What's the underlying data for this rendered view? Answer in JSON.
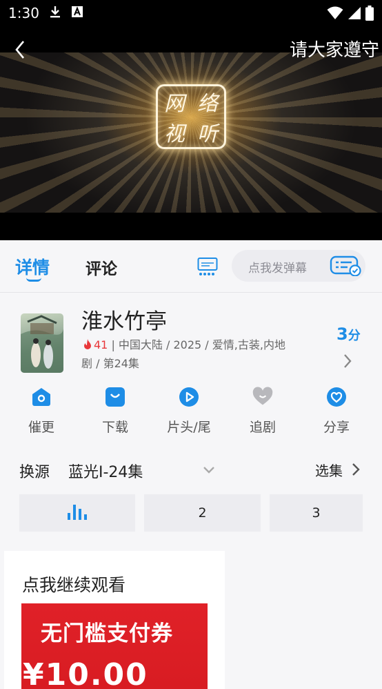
{
  "status_bar": {
    "time": "1:30",
    "icons": [
      "download-icon",
      "a11y-icon"
    ],
    "right_icons": [
      "wifi-icon",
      "signal-icon",
      "battery-icon"
    ]
  },
  "player": {
    "title": "请大家遵守",
    "logo_glyphs": [
      "网",
      "络",
      "视",
      "听"
    ]
  },
  "tabs": {
    "detail": "详情",
    "comment": "评论"
  },
  "danmu": {
    "placeholder": "点我发弹幕"
  },
  "show": {
    "title": "淮水竹亭",
    "hot": "41",
    "meta_line1": " | 中国大陆 / 2025 / 爱情,古装,内地",
    "meta_line2": "剧 / 第24集",
    "score_value": "3",
    "score_unit": "分"
  },
  "actions": [
    {
      "label": "催更",
      "icon": "home-icon"
    },
    {
      "label": "下载",
      "icon": "download-bag-icon"
    },
    {
      "label": "片头/尾",
      "icon": "play-icon"
    },
    {
      "label": "追剧",
      "icon": "heart-icon"
    },
    {
      "label": "分享",
      "icon": "share-heart-icon"
    }
  ],
  "source": {
    "label": "换源",
    "value": "蓝光I-24集",
    "pick_label": "选集"
  },
  "episodes": {
    "ep2": "2",
    "ep3": "3"
  },
  "card": {
    "title": "点我继续观看",
    "ad_text": "无门槛支付券",
    "ad_price": "¥10.00"
  },
  "colors": {
    "accent": "#1e8de6",
    "hot": "#e8373a",
    "ad_red": "#e02128"
  }
}
